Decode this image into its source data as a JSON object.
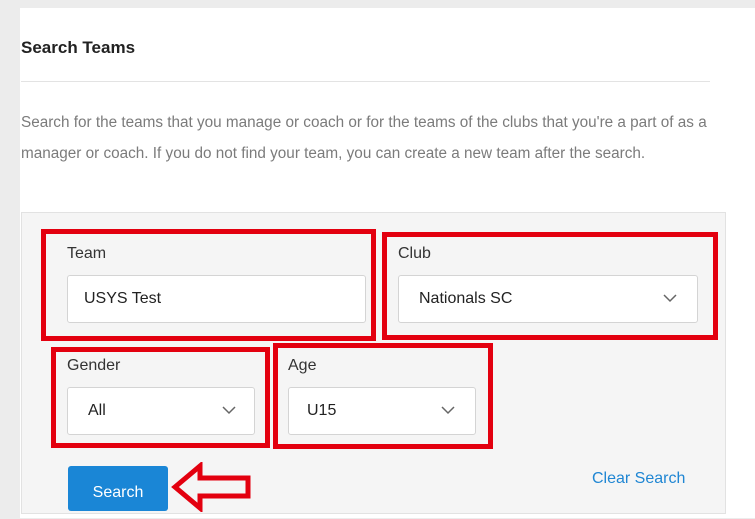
{
  "panel": {
    "title": "Search Teams",
    "description": "Search for the teams that you manage or coach or for the teams of the clubs that you're a part of as a manager or coach. If you do not find your team, you can create a new team after the search."
  },
  "form": {
    "team": {
      "label": "Team",
      "value": "USYS Test"
    },
    "club": {
      "label": "Club",
      "value": "Nationals SC"
    },
    "gender": {
      "label": "Gender",
      "value": "All"
    },
    "age": {
      "label": "Age",
      "value": "U15"
    },
    "search_label": "Search",
    "clear_label": "Clear Search"
  },
  "colors": {
    "highlight": "#e3000f",
    "primary_button": "#1a86d6",
    "link": "#1f86d3"
  },
  "icons": [
    "chevron-down-icon",
    "left-arrow-annotation-icon"
  ]
}
